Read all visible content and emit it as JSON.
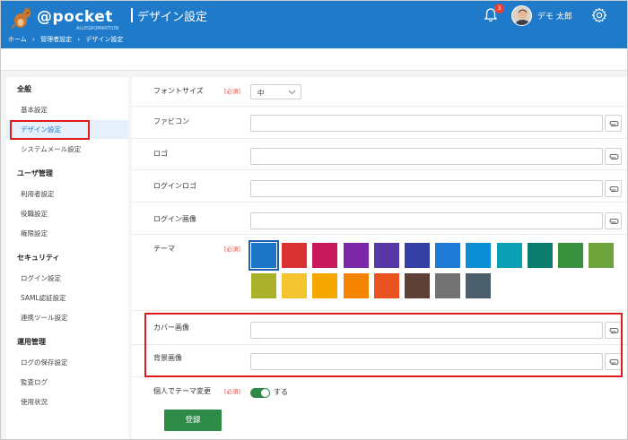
{
  "header": {
    "logo_text": "@pocket",
    "logo_sub": "ALLEGROMANTION",
    "title": "デザイン設定",
    "notification_count": "3",
    "user_name": "デモ 太郎",
    "bg_color": "#1f7bc9"
  },
  "breadcrumb": [
    "ホーム",
    "›",
    "管理者設定",
    "›",
    "デザイン設定"
  ],
  "sidebar": {
    "sections": [
      {
        "heading": "全般",
        "items": [
          "基本設定",
          "デザイン設定",
          "システムメール設定"
        ]
      },
      {
        "heading": "ユーザ管理",
        "items": [
          "利用者設定",
          "役職設定",
          "権限設定"
        ]
      },
      {
        "heading": "セキュリティ",
        "items": [
          "ログイン設定",
          "SAML認証設定",
          "連携ツール設定"
        ]
      },
      {
        "heading": "運用管理",
        "items": [
          "ログの保存設定",
          "監査ログ",
          "使用状況"
        ]
      }
    ],
    "active_item": "デザイン設定"
  },
  "form": {
    "required_label": "[必須]",
    "font_size": {
      "label": "フォントサイズ",
      "value": "中"
    },
    "favicon": {
      "label": "ファビコン",
      "value": ""
    },
    "logo": {
      "label": "ロゴ",
      "value": ""
    },
    "login_logo": {
      "label": "ログインロゴ",
      "value": ""
    },
    "login_image": {
      "label": "ログイン画像",
      "value": ""
    },
    "theme": {
      "label": "テーマ",
      "colors": [
        "#1b74c5",
        "#d83232",
        "#c8195c",
        "#7b28a8",
        "#5736a8",
        "#3440a3",
        "#1f7ad6",
        "#0a8ed4",
        "#0a9fb4",
        "#0a7d6e",
        "#3a913e",
        "#6ea33c",
        "#aab12a",
        "#f4c431",
        "#f7a800",
        "#f48300",
        "#e8531f",
        "#5e4036",
        "#727272",
        "#4a5e6b"
      ],
      "selected_index": 0
    },
    "cover_image": {
      "label": "カバー画像",
      "value": ""
    },
    "background_image": {
      "label": "背景画像",
      "value": ""
    },
    "personal_theme": {
      "label": "個人でテーマ変更",
      "toggle_label": "する",
      "enabled": true
    },
    "submit_label": "登録"
  }
}
